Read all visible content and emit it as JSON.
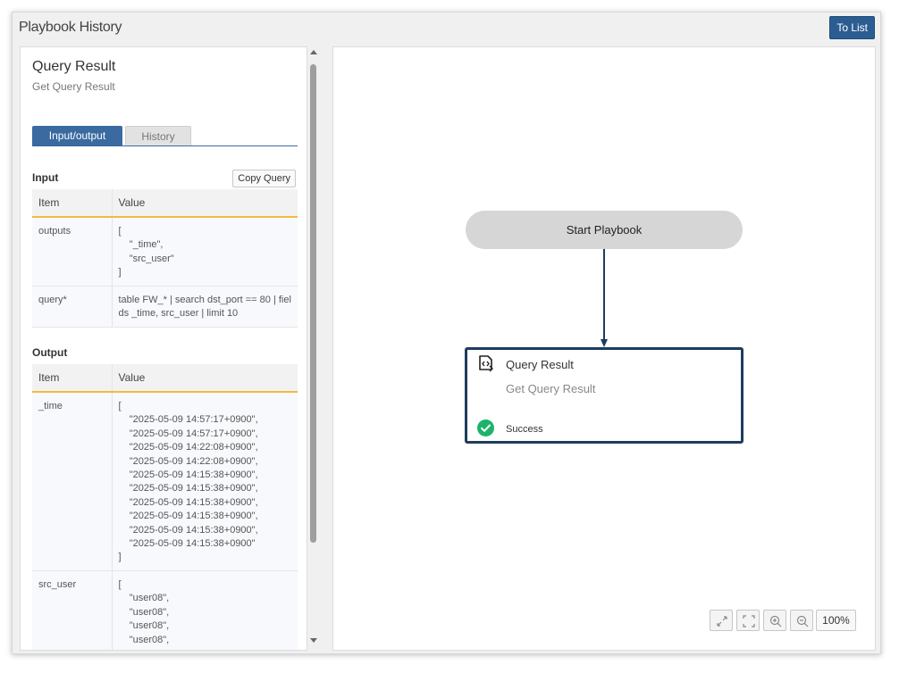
{
  "window": {
    "title": "Playbook History",
    "to_list_label": "To List"
  },
  "panel": {
    "node_title": "Query Result",
    "node_subtitle": "Get Query Result",
    "tabs": [
      {
        "label": "Input/output",
        "active": true
      },
      {
        "label": "History",
        "active": false
      }
    ],
    "input": {
      "label": "Input",
      "copy_label": "Copy Query",
      "headers": {
        "item": "Item",
        "value": "Value"
      },
      "rows": [
        {
          "item": "outputs",
          "value": "[\n    \"_time\",\n    \"src_user\"\n]"
        },
        {
          "item": "query*",
          "value": "table FW_* | search dst_port == 80 | fields _time, src_user | limit 10"
        }
      ]
    },
    "output": {
      "label": "Output",
      "headers": {
        "item": "Item",
        "value": "Value"
      },
      "rows": [
        {
          "item": "_time",
          "value": "[\n    \"2025-05-09 14:57:17+0900\",\n    \"2025-05-09 14:57:17+0900\",\n    \"2025-05-09 14:22:08+0900\",\n    \"2025-05-09 14:22:08+0900\",\n    \"2025-05-09 14:15:38+0900\",\n    \"2025-05-09 14:15:38+0900\",\n    \"2025-05-09 14:15:38+0900\",\n    \"2025-05-09 14:15:38+0900\",\n    \"2025-05-09 14:15:38+0900\",\n    \"2025-05-09 14:15:38+0900\"\n]"
        },
        {
          "item": "src_user",
          "value": "[\n    \"user08\",\n    \"user08\",\n    \"user08\",\n    \"user08\","
        }
      ]
    }
  },
  "canvas": {
    "start_node_label": "Start Playbook",
    "task_node": {
      "title": "Query Result",
      "subtitle": "Get Query Result",
      "status": "Success",
      "icon": "script-icon",
      "status_icon": "check-circle-icon",
      "status_color": "#1db36b"
    },
    "edge_color": "#1c3d5e",
    "zoom_level": "100%",
    "controls": [
      "expand-icon",
      "fit-screen-icon",
      "zoom-in-icon",
      "zoom-out-icon"
    ]
  },
  "colors": {
    "accent": "#2c5d92",
    "tab_active": "#3a6aa0",
    "table_header_rule": "#f4b93e"
  }
}
